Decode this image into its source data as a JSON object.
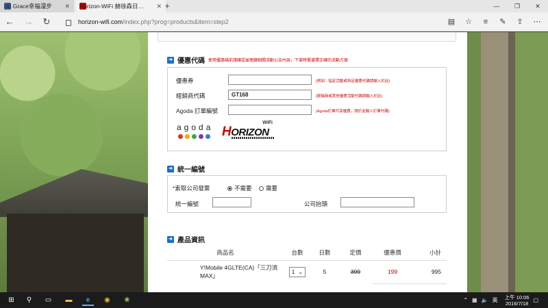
{
  "browser": {
    "tabs": [
      {
        "label": "(4) Grace幸福漫步",
        "favicon_color": "#3b5998"
      },
      {
        "label": "Horizon-WiFi 赫徐森日…",
        "favicon_color": "#c00000"
      }
    ],
    "url_host": "horizon-wifi.com",
    "url_path": "/index.php?prog=products&item=step2"
  },
  "coupon": {
    "title": "優惠代碼",
    "note": "使用優惠碼前請確認並閱讀相關活動公告內容，下單時需選擇正確的活動方案",
    "rows": [
      {
        "label": "優惠券",
        "value": "",
        "hint": "(例如：指定活動或特定優惠代碼請輸入於此)"
      },
      {
        "label": "經銷商代碼",
        "value": "GT168",
        "hint": "(經銷商或其他優惠活動代碼請輸入於此)"
      },
      {
        "label": "Agoda 訂單編號",
        "value": "",
        "hint": "(Agoda訂單可享優惠，請於此輸入訂單代碼)"
      }
    ],
    "agoda_text": "agoda",
    "agoda_dots": [
      "#e53030",
      "#f2a900",
      "#3aa93a",
      "#8a2fc0",
      "#2f7fd8"
    ],
    "horizon_wifi": "WiFi",
    "horizon_word": "ORIZON",
    "horizon_h": "H"
  },
  "invoice": {
    "title": "統一編號",
    "required_mark": "*",
    "question": "索取公司發票",
    "opt_no": "不需要",
    "opt_yes": "需要",
    "tax_id_label": "統一編號",
    "company_label": "公司抬頭"
  },
  "product": {
    "title": "產品資訊",
    "headers": [
      "商品名",
      "台數",
      "日數",
      "定價",
      "優惠價",
      "小計"
    ],
    "rows": [
      {
        "name": "Y!Mobile 4GLTE(CA)「三刀流MAX」",
        "qty": "1",
        "days": "5",
        "list_price": "399",
        "sale_price": "199",
        "subtotal": "995"
      }
    ],
    "subtotal_label": "小計",
    "subtotal_value": "995"
  },
  "taskbar": {
    "time": "上午 10:06",
    "date": "2016/7/18"
  }
}
